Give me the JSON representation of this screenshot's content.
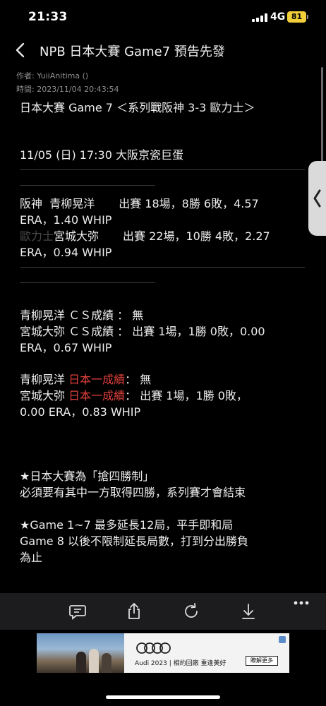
{
  "status_bar": {
    "time": "21:33",
    "network": "4G",
    "battery": "81"
  },
  "nav": {
    "back_icon": "chevron-left-icon",
    "title": "NPB 日本大賽 Game7 預告先發"
  },
  "post": {
    "author": "作者: YuiiAnitima ()",
    "time": "時間: 2023/11/04 20:43:54",
    "headline": "日本大賽 Game 7 ＜系列戰阪神 3-3 歐力士＞",
    "date_line": "11/05 (日) 17:30  大阪京瓷巨蛋",
    "hanshin": {
      "team": "阪神",
      "pitcher": "青柳晃洋",
      "stats_1": "出賽 18場，8勝 6敗，4.57",
      "stats_2": "ERA，1.40 WHIP"
    },
    "orix": {
      "team": "歐力士",
      "pitcher": "宮城大弥",
      "stats_1": "出賽 22場，10勝 4敗，2.27",
      "stats_2": "ERA，0.94 WHIP"
    },
    "cs": {
      "line1": "青柳晃洋  ＣＳ成績 ：  無",
      "line2": "宮城大弥  ＣＳ成績 ：  出賽 1場，1勝 0敗，0.00",
      "line3": "ERA，0.67 WHIP"
    },
    "japan_series": {
      "p1_name": "青柳晃洋  ",
      "p1_label": "日本一成績",
      "p1_value": "：  無",
      "p2_name": "宮城大弥  ",
      "p2_label": "日本一成績",
      "p2_value": "：  出賽 1場，1勝 0敗，",
      "p2_line2": "0.00 ERA，0.83 WHIP"
    },
    "notes": {
      "n1_line1": "★日本大賽為「搶四勝制」",
      "n1_line2": "  必須要有其中一方取得四勝，系列賽才會結束",
      "n2_line1": "★Game 1~7 最多延長12局，平手即和局",
      "n2_line2": "  Game 8 以後不限制延長局數，打到分出勝負",
      "n2_line3": "為止"
    }
  },
  "toolbar": {
    "icons": [
      "comment-icon",
      "share-icon",
      "refresh-icon",
      "download-icon",
      "more-icon"
    ]
  },
  "ad": {
    "brand_text": "Audi 2023 | 相約回廠 重逢美好",
    "button_label": "瞭解更多"
  },
  "colors": {
    "accent_red": "#e0413c",
    "battery": "#f2cf3a",
    "background": "#000000",
    "toolbar": "#1c1c1e"
  }
}
